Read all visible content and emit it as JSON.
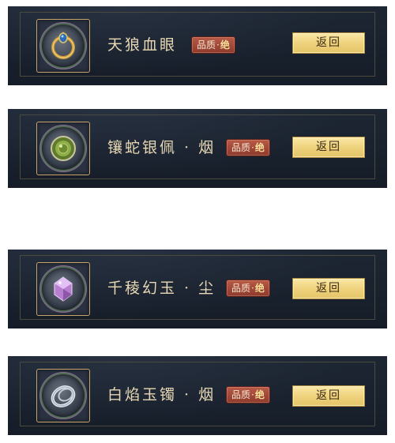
{
  "items": [
    {
      "name": "天狼血眼",
      "quality_label": "品质",
      "quality_separator": "·",
      "quality_value": "绝",
      "back_label": "返回",
      "icon": "gold-ring-icon",
      "accent": "#2b6fb8"
    },
    {
      "name": "镶蛇银佩 · 烟",
      "quality_label": "品质",
      "quality_separator": "·",
      "quality_value": "绝",
      "back_label": "返回",
      "icon": "jade-pendant-icon",
      "accent": "#7e9a3c"
    },
    {
      "name": "千稜幻玉 · 尘",
      "quality_label": "品质",
      "quality_separator": "·",
      "quality_value": "绝",
      "back_label": "返回",
      "icon": "purple-crystal-icon",
      "accent": "#c48ad6"
    },
    {
      "name": "白焰玉镯 · 烟",
      "quality_label": "品质",
      "quality_separator": "·",
      "quality_value": "绝",
      "back_label": "返回",
      "icon": "white-bracelet-icon",
      "accent": "#cfd8e3"
    }
  ],
  "colors": {
    "card_background": "#1a2230",
    "item_name_text": "#e8d9b4",
    "quality_badge": "#a04a3a",
    "back_button": "#f0d584",
    "frame_border": "#c7a46c"
  }
}
